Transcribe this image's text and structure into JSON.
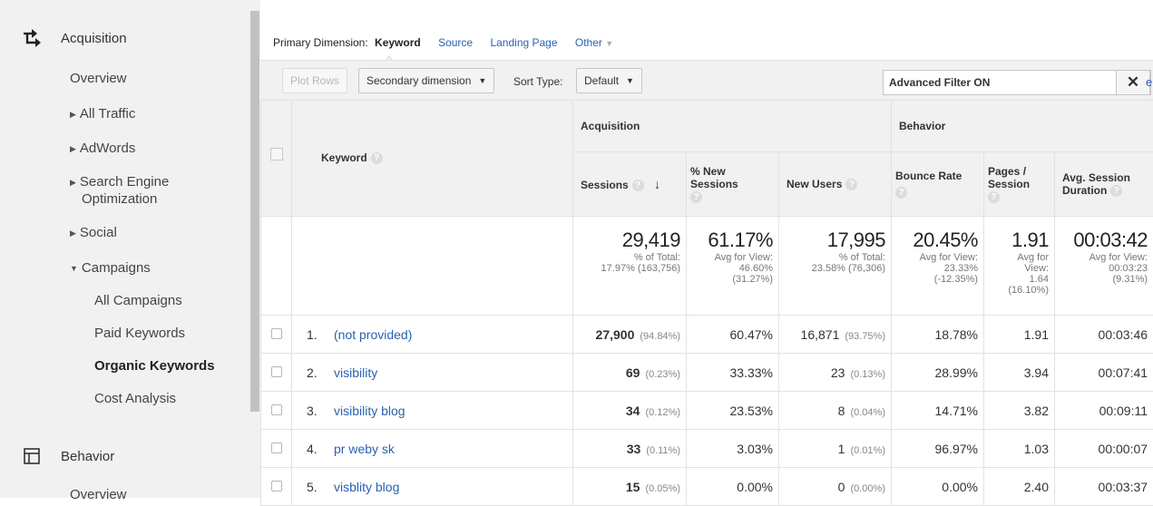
{
  "sidebar": {
    "acquisition": {
      "label": "Acquisition",
      "items": [
        {
          "label": "Overview"
        },
        {
          "label": "All Traffic"
        },
        {
          "label": "AdWords"
        },
        {
          "label": "Search Engine"
        },
        {
          "label": "Optimization"
        },
        {
          "label": "Social"
        },
        {
          "label": "Campaigns"
        }
      ],
      "campaigns_children": [
        "All Campaigns",
        "Paid Keywords",
        "Organic Keywords",
        "Cost Analysis"
      ]
    },
    "behavior": {
      "label": "Behavior",
      "overview": "Overview"
    }
  },
  "primary_dimension": {
    "label": "Primary Dimension:",
    "current": "Keyword",
    "options": [
      "Source",
      "Landing Page"
    ],
    "other": "Other"
  },
  "toolbar": {
    "plot_rows": "Plot Rows",
    "secondary_dimension": "Secondary dimension",
    "sort_type_label": "Sort Type:",
    "sort_type_value": "Default",
    "filter_text": "Advanced Filter ON",
    "filter_clear": "✕",
    "edge_letter": "e"
  },
  "table": {
    "keyword_header": "Keyword",
    "group_acquisition": "Acquisition",
    "group_behavior": "Behavior",
    "columns": {
      "sessions": "Sessions",
      "new_sessions_line1": "% New",
      "new_sessions_line2": "Sessions",
      "new_users": "New Users",
      "bounce_rate": "Bounce Rate",
      "pages_line1": "Pages /",
      "pages_line2": "Session",
      "avg_line1": "Avg. Session",
      "avg_line2": "Duration"
    },
    "summary": {
      "sessions": {
        "value": "29,419",
        "l1": "% of Total:",
        "l2": "17.97% (163,756)"
      },
      "new_sessions": {
        "value": "61.17%",
        "l1": "Avg for View:",
        "l2": "46.60%",
        "l3": "(31.27%)"
      },
      "new_users": {
        "value": "17,995",
        "l1": "% of Total:",
        "l2": "23.58% (76,306)"
      },
      "bounce_rate": {
        "value": "20.45%",
        "l1": "Avg for View:",
        "l2": "23.33%",
        "l3": "(-12.35%)"
      },
      "pages": {
        "value": "1.91",
        "l1": "Avg for",
        "l2": "View:",
        "l3": "1.64",
        "l4": "(16.10%)"
      },
      "avg_duration": {
        "value": "00:03:42",
        "l1": "Avg for View:",
        "l2": "00:03:23",
        "l3": "(9.31%)"
      }
    },
    "rows": [
      {
        "num": "1.",
        "keyword": "(not provided)",
        "sessions": "27,900",
        "sessions_pct": "(94.84%)",
        "new_sessions": "60.47%",
        "new_users": "16,871",
        "new_users_pct": "(93.75%)",
        "bounce": "18.78%",
        "pages": "1.91",
        "duration": "00:03:46"
      },
      {
        "num": "2.",
        "keyword": "visibility",
        "sessions": "69",
        "sessions_pct": "(0.23%)",
        "new_sessions": "33.33%",
        "new_users": "23",
        "new_users_pct": "(0.13%)",
        "bounce": "28.99%",
        "pages": "3.94",
        "duration": "00:07:41"
      },
      {
        "num": "3.",
        "keyword": "visibility blog",
        "sessions": "34",
        "sessions_pct": "(0.12%)",
        "new_sessions": "23.53%",
        "new_users": "8",
        "new_users_pct": "(0.04%)",
        "bounce": "14.71%",
        "pages": "3.82",
        "duration": "00:09:11"
      },
      {
        "num": "4.",
        "keyword": "pr weby sk",
        "sessions": "33",
        "sessions_pct": "(0.11%)",
        "new_sessions": "3.03%",
        "new_users": "1",
        "new_users_pct": "(0.01%)",
        "bounce": "96.97%",
        "pages": "1.03",
        "duration": "00:00:07"
      },
      {
        "num": "5.",
        "keyword": "visblity blog",
        "sessions": "15",
        "sessions_pct": "(0.05%)",
        "new_sessions": "0.00%",
        "new_users": "0",
        "new_users_pct": "(0.00%)",
        "bounce": "0.00%",
        "pages": "2.40",
        "duration": "00:03:37"
      }
    ]
  },
  "colors": {
    "link": "#2962b3",
    "sidebar_bg": "#f1f1f1",
    "header_bg": "#f1f1f1"
  },
  "icons": [
    "acquisition-arrows-icon",
    "behavior-window-icon",
    "sort-down-arrow-icon",
    "help-icon"
  ]
}
